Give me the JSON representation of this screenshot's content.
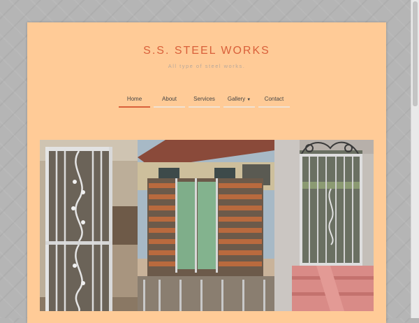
{
  "site": {
    "title": "S.S. STEEL WORKS",
    "tagline": "All type of steel works."
  },
  "nav": {
    "items": [
      {
        "label": "Home",
        "active": true
      },
      {
        "label": "About"
      },
      {
        "label": "Services"
      },
      {
        "label": "Gallery",
        "has_dropdown": true,
        "caret": "▼"
      },
      {
        "label": "Contact"
      }
    ]
  },
  "gallery": {
    "images": [
      "steel-door-photo",
      "steel-gate-photo",
      "steel-small-gate-photo"
    ]
  },
  "colors": {
    "page_background": "#ffcb97",
    "title": "#d9603a",
    "nav_active_underline": "#d9603a"
  }
}
